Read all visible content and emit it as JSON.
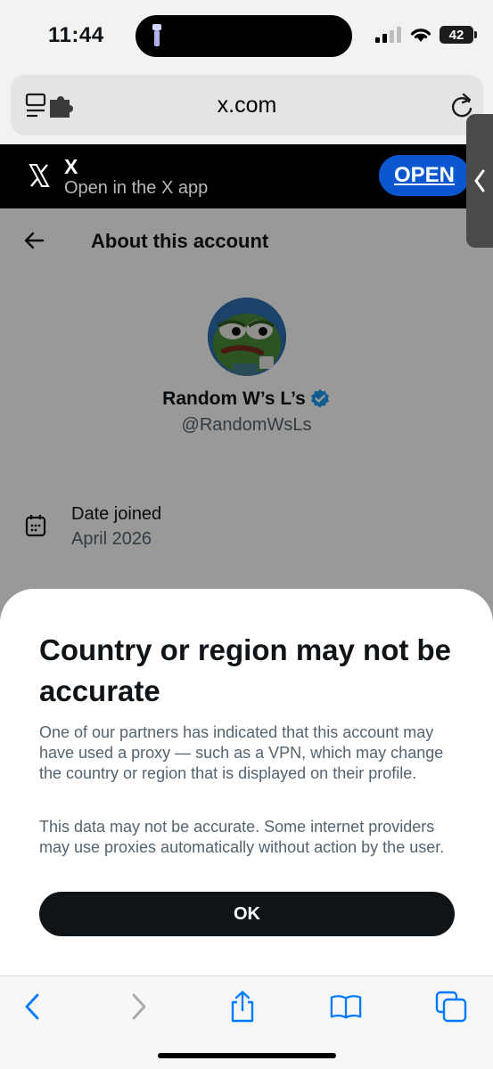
{
  "status_bar": {
    "time": "11:44",
    "battery": "42"
  },
  "browser": {
    "url": "x.com"
  },
  "app_banner": {
    "title": "X",
    "subtitle": "Open in the X app",
    "open_label": "OPEN"
  },
  "page": {
    "title": "About this account",
    "profile": {
      "name": "Random W’s L’s",
      "handle": "@RandomWsLs",
      "verified": true
    },
    "date_joined": {
      "label": "Date joined",
      "value": "April 2026"
    }
  },
  "sheet": {
    "title": "Country or region may not be accurate",
    "body_1": "One of our partners has indicated that this account may have used a proxy — such as a VPN, which may change the country or region that is displayed on their profile.",
    "body_2": "This data may not be accurate. Some internet providers may use proxies automatically without action by the user.",
    "ok_label": "OK"
  },
  "colors": {
    "accent": "#1d9bf0",
    "banner_button": "#0b57d0",
    "safari_blue": "#007aff"
  }
}
